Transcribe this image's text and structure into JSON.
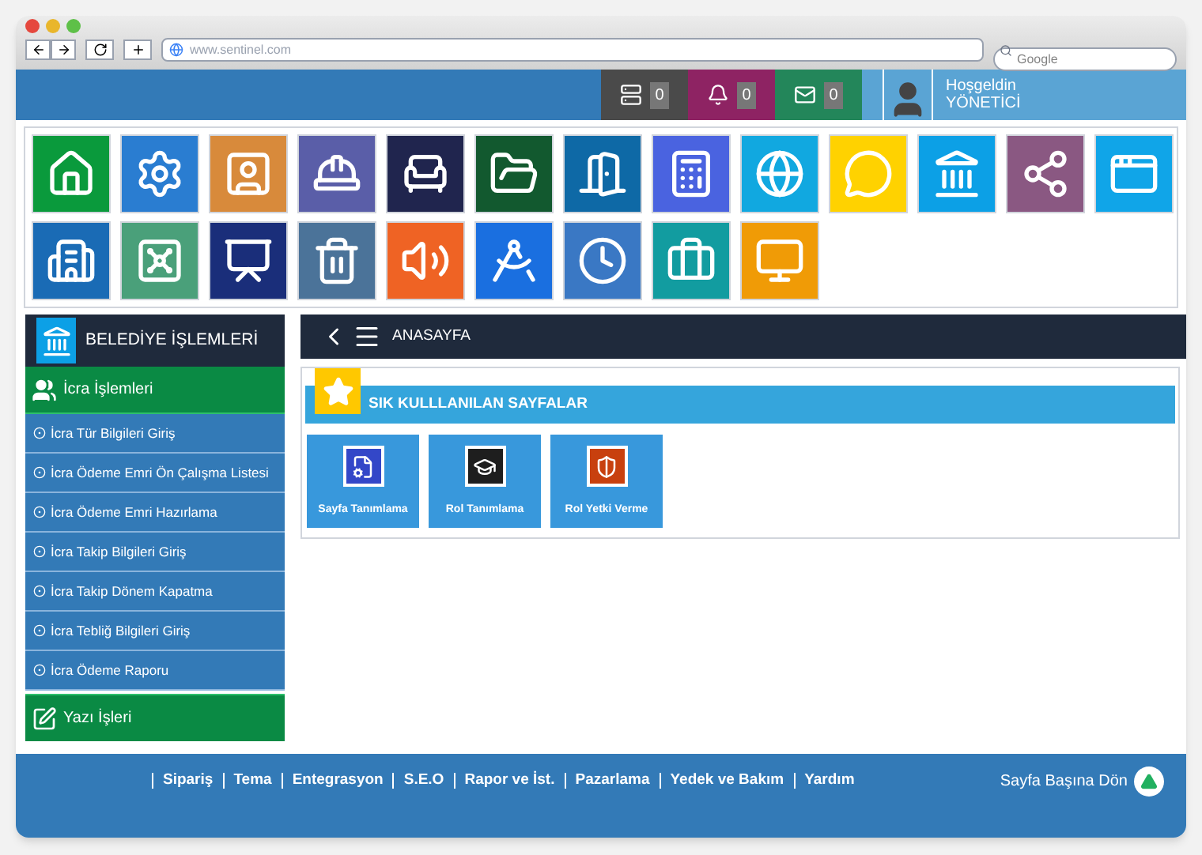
{
  "browser": {
    "address": "www.sentinel.com",
    "search": {
      "placeholder": "Google"
    }
  },
  "header": {
    "badges": [
      {
        "kind": "server",
        "count": "0",
        "color": "#4a4a4a"
      },
      {
        "kind": "bell",
        "count": "0",
        "color": "#8e2363"
      },
      {
        "kind": "mail",
        "count": "0",
        "color": "#23865a"
      }
    ],
    "greeting": "Hoşgeldin",
    "user": "YÖNETİCİ"
  },
  "tiles": [
    {
      "color": "#0a9a3c"
    },
    {
      "color": "#2a7dd1"
    },
    {
      "color": "#d88a3b"
    },
    {
      "color": "#5a5ea8"
    },
    {
      "color": "#20254e"
    },
    {
      "color": "#12592f"
    },
    {
      "color": "#0e69a6"
    },
    {
      "color": "#4a63e0"
    },
    {
      "color": "#11a8e0"
    },
    {
      "color": "#ffd200"
    },
    {
      "color": "#0ca0e6"
    },
    {
      "color": "#8a5882"
    },
    {
      "color": "#10a5e8"
    },
    {
      "color": "#1a6bb5"
    },
    {
      "color": "#4aa07a"
    },
    {
      "color": "#1a2e7a"
    },
    {
      "color": "#4b7399"
    },
    {
      "color": "#ef6324"
    },
    {
      "color": "#1a6fe0"
    },
    {
      "color": "#3a78c4"
    },
    {
      "color": "#129ca0"
    },
    {
      "color": "#f09b06"
    }
  ],
  "sidebar": {
    "title": "BELEDİYE İŞLEMLERİ",
    "groups": [
      {
        "label": "İcra İşlemleri",
        "expanded": true,
        "items": [
          "İcra Tür Bilgileri Giriş",
          "İcra Ödeme Emri Ön Çalışma Listesi",
          "İcra Ödeme Emri Hazırlama",
          "İcra Takip Bilgileri Giriş",
          "İcra Takip Dönem Kapatma",
          "İcra Tebliğ Bilgileri Giriş",
          "İcra Ödeme Raporu"
        ]
      },
      {
        "label": "Yazı İşleri",
        "expanded": false
      }
    ]
  },
  "breadcrumb": "ANASAYFA",
  "favorites": {
    "title": "SIK KULLLANILAN SAYFALAR",
    "items": [
      {
        "label": "Sayfa Tanımlama",
        "color": "#3347c8"
      },
      {
        "label": "Rol Tanımlama",
        "color": "#1e1e1e"
      },
      {
        "label": "Rol Yetki Verme",
        "color": "#c8400e"
      }
    ]
  },
  "footer": {
    "links": [
      "Sipariş",
      "Tema",
      "Entegrasyon",
      "S.E.O",
      "Rapor ve İst.",
      "Pazarlama",
      "Yedek ve Bakım",
      "Yardım"
    ],
    "back_to_top": "Sayfa Başına Dön"
  }
}
